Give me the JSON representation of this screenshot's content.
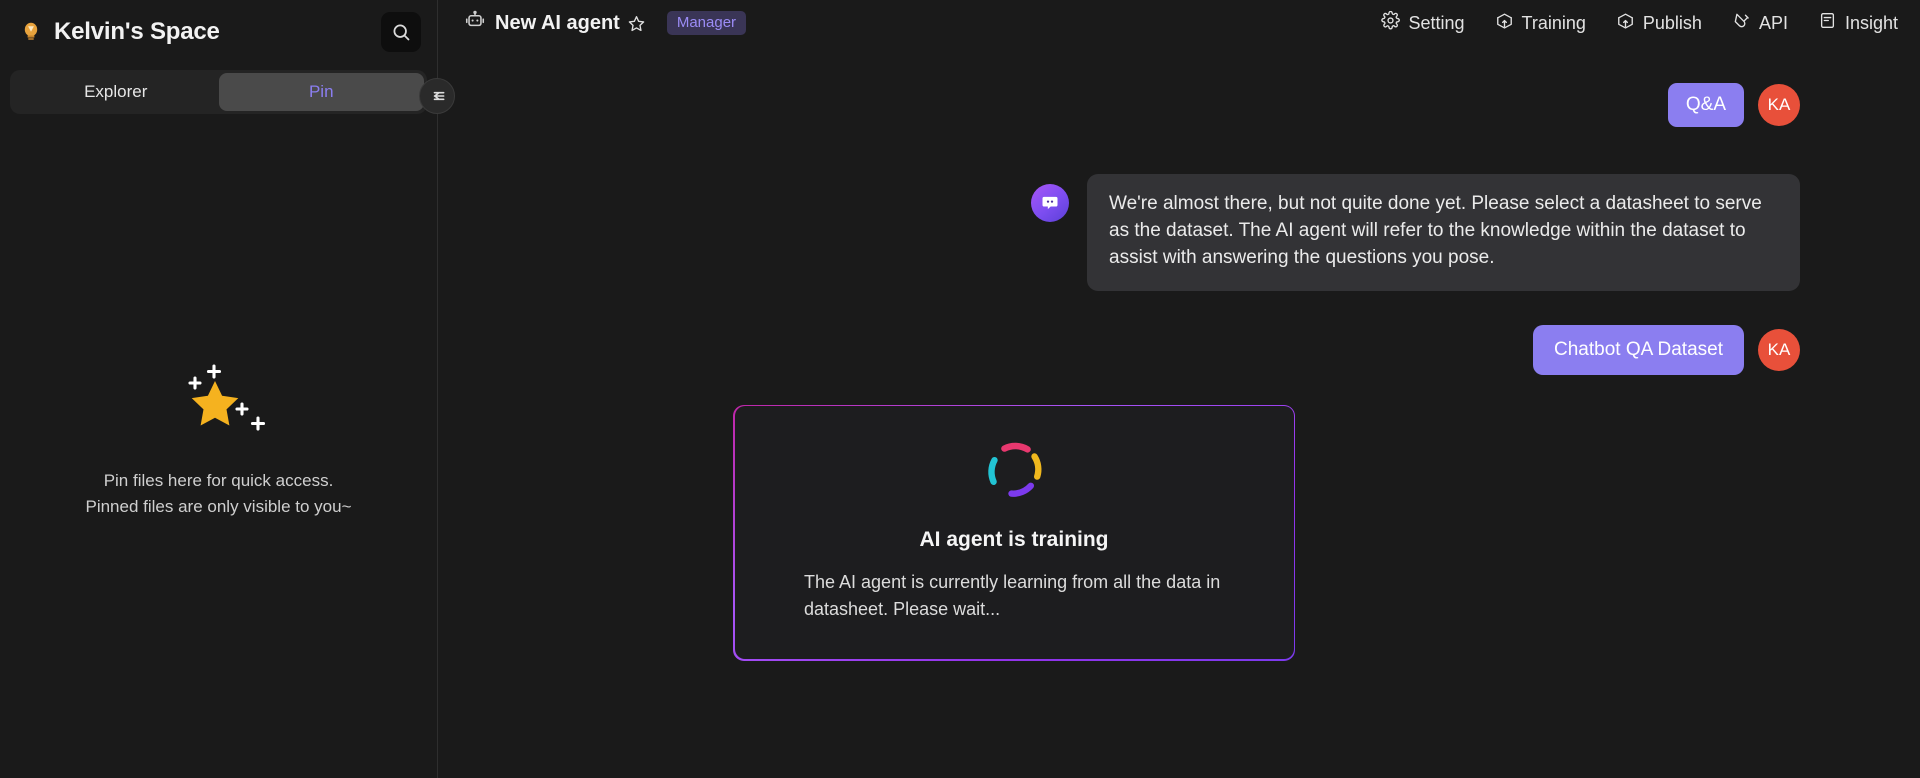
{
  "sidebar": {
    "logo_icon": "lightbulb-icon",
    "space_title": "Kelvin's Space",
    "search_icon": "search-icon",
    "tabs": [
      {
        "label": "Explorer",
        "active": false
      },
      {
        "label": "Pin",
        "active": true
      }
    ],
    "empty_state": {
      "illustration_icon": "star-sparkle-icon",
      "line1": "Pin files here for quick access.",
      "line2": "Pinned files are only visible to you~"
    },
    "collapse_icon": "collapse-sidebar-icon"
  },
  "topbar": {
    "agent_icon": "robot-icon",
    "agent_name": "New AI agent",
    "favorite_icon": "star-outline-icon",
    "role_badge": "Manager",
    "nav": [
      {
        "label": "Setting",
        "icon": "gear-icon"
      },
      {
        "label": "Training",
        "icon": "box-upload-icon"
      },
      {
        "label": "Publish",
        "icon": "box-upload-icon"
      },
      {
        "label": "API",
        "icon": "plug-icon"
      },
      {
        "label": "Insight",
        "icon": "document-icon"
      }
    ]
  },
  "chat": {
    "qa_badge": "Q&A",
    "user_avatar_initials": "KA",
    "bot_avatar_icon": "chat-bubble-icon",
    "bot_message": "We're almost there, but not quite done yet. Please select a datasheet to serve as the dataset. The AI agent will refer to the knowledge within the dataset to assist with answering the questions you pose.",
    "user_message": "Chatbot QA Dataset"
  },
  "training_card": {
    "spinner_icon": "loading-spinner-icon",
    "title": "AI agent is training",
    "description": "The AI agent is currently learning from all the data in datasheet. Please wait..."
  },
  "colors": {
    "page_bg": "#1a1a1a",
    "accent_purple": "#8b7ef0",
    "avatar_red": "#e8503a",
    "badge_purple_bg": "#3a3556",
    "badge_purple_text": "#9b8cf5",
    "bot_bubble_bg": "#333336",
    "card_border_gradient_start": "#c026a8",
    "card_border_gradient_end": "#7c3aed",
    "star_gold": "#f5b21f",
    "spinner_pink": "#e8386f",
    "spinner_yellow": "#f0b81e",
    "spinner_purple": "#7c3aed",
    "spinner_cyan": "#22c4d4"
  }
}
